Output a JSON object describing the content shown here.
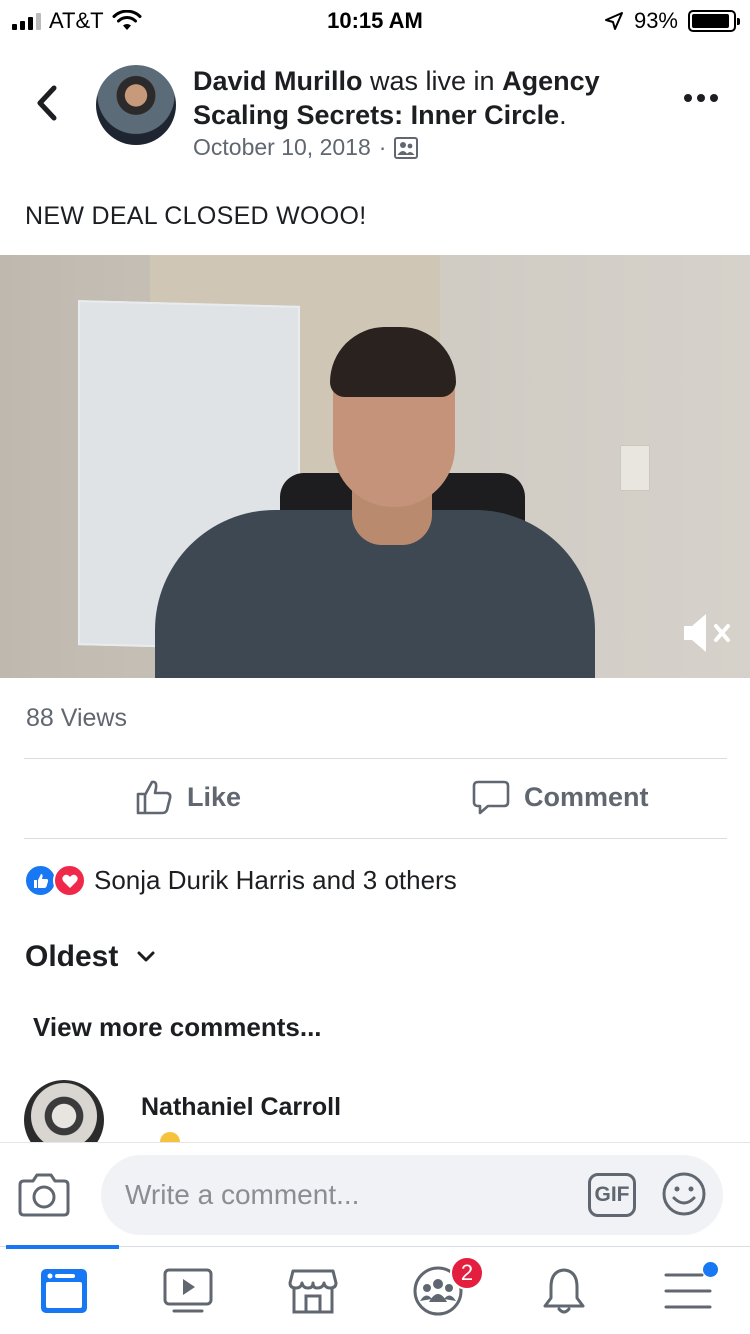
{
  "status_bar": {
    "carrier": "AT&T",
    "time": "10:15 AM",
    "battery": "93%",
    "battery_level": 0.93
  },
  "post": {
    "author": "David Murillo",
    "action_text": " was live in ",
    "group": "Agency Scaling Secrets: Inner Circle",
    "title_end": ".",
    "date": "October 10, 2018",
    "separator": "·",
    "privacy_icon": "group-icon",
    "caption": "NEW DEAL CLOSED WOOO!"
  },
  "video": {
    "muted_icon": "speaker-muted-icon"
  },
  "stats": {
    "views": "88 Views"
  },
  "actions": {
    "like_label": "Like",
    "comment_label": "Comment"
  },
  "reactions": {
    "icons": [
      "like-reaction-icon",
      "love-reaction-icon"
    ],
    "summary": "Sonja Durik Harris and 3 others"
  },
  "comments": {
    "sort_label": "Oldest",
    "view_more": "View more comments...",
    "items": [
      {
        "author": "Nathaniel Carroll"
      }
    ]
  },
  "composer": {
    "placeholder": "Write a comment...",
    "gif_label": "GIF"
  },
  "tabbar": {
    "tabs": [
      "news-feed-icon",
      "watch-icon",
      "marketplace-icon",
      "groups-icon",
      "notifications-icon",
      "menu-icon"
    ],
    "groups_badge": "2"
  },
  "colors": {
    "accent": "#1877f2",
    "badge": "#e41e3f",
    "secondary_text": "#606770"
  }
}
